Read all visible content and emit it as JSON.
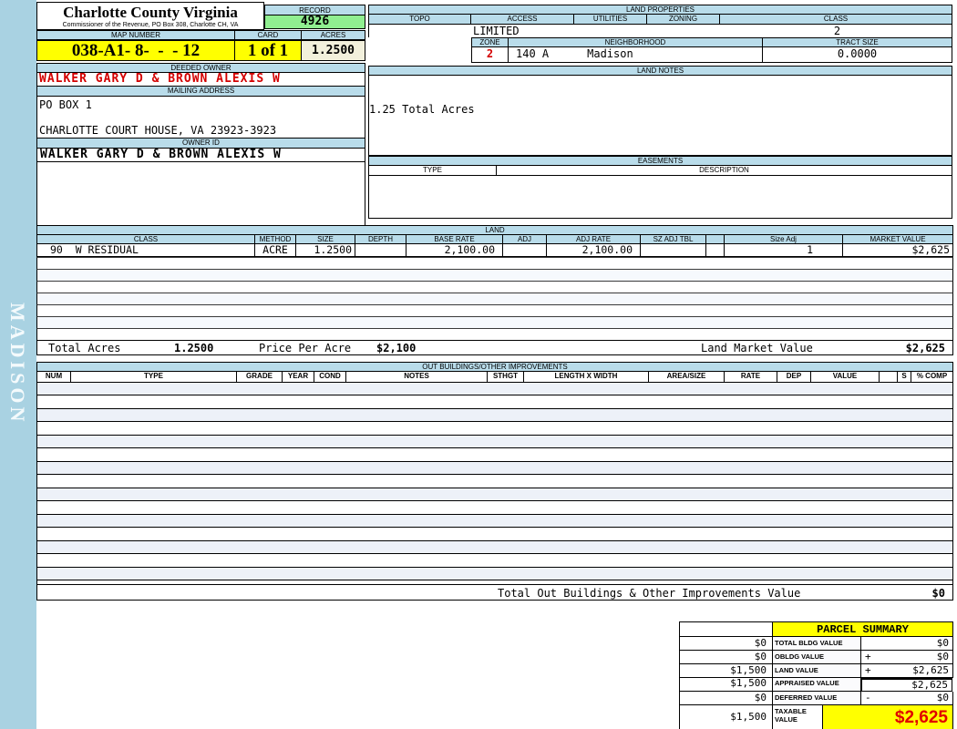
{
  "sidebar": {
    "district_label": "MADISON"
  },
  "header": {
    "county_title": "Charlotte County Virginia",
    "commissioner_line": "Commissioner of the Revenue, PO Box 308, Charlotte CH, VA",
    "record_label": "RECORD",
    "record_value": "4926",
    "map_number_label": "MAP NUMBER",
    "map_number_value": "038-A1- 8-  -  - 12",
    "card_label": "CARD",
    "card_value": "1 of 1",
    "acres_label": "ACRES",
    "acres_value": "1.2500"
  },
  "owner": {
    "deeded_owner_label": "DEEDED OWNER",
    "deeded_owner_value": "WALKER GARY D & BROWN ALEXIS W",
    "mailing_address_label": "MAILING ADDRESS",
    "mailing_address_line1": "PO BOX 1",
    "mailing_address_line2": "CHARLOTTE COURT HOUSE, VA 23923-3923",
    "owner_id_label": "OWNER ID",
    "owner_id_value": "WALKER GARY D & BROWN ALEXIS W"
  },
  "land_properties": {
    "title": "LAND PROPERTIES",
    "topo_label": "TOPO",
    "access_label": "ACCESS",
    "utilities_label": "UTILITIES",
    "zoning_label": "ZONING",
    "class_label": "CLASS",
    "topo_value": "",
    "access_value": "LIMITED",
    "utilities_value": "",
    "zoning_value": "",
    "class_value": "2",
    "zone_label": "ZONE",
    "neighborhood_label": "NEIGHBORHOOD",
    "tract_size_label": "TRACT SIZE",
    "zone_value": "2",
    "neighborhood_code": "140 A",
    "neighborhood_name": "Madison",
    "tract_size_value": "0.0000"
  },
  "land_notes": {
    "title": "LAND NOTES",
    "note": "1.25 Total Acres"
  },
  "easements": {
    "title": "EASEMENTS",
    "type_label": "TYPE",
    "description_label": "DESCRIPTION"
  },
  "land_table": {
    "title": "LAND",
    "headers": [
      "CLASS",
      "METHOD",
      "SIZE",
      "DEPTH",
      "BASE RATE",
      "ADJ",
      "ADJ RATE",
      "SZ ADJ TBL",
      "",
      "Size Adj",
      "MARKET VALUE"
    ],
    "rows": [
      {
        "class": "90  W RESIDUAL",
        "method": "ACRE",
        "size": "1.2500",
        "depth": "",
        "base_rate": "2,100.00",
        "adj": "",
        "adj_rate": "2,100.00",
        "sz_adj_tbl": "",
        "size_adj": "1",
        "market_value": "$2,625"
      }
    ],
    "empty_row_count": 7,
    "totals": {
      "total_acres_label": "Total Acres",
      "total_acres_value": "1.2500",
      "price_per_acre_label": "Price Per Acre",
      "price_per_acre_value": "$2,100",
      "land_market_value_label": "Land Market Value",
      "land_market_value": "$2,625"
    }
  },
  "out_buildings": {
    "title": "OUT BUILDINGS/OTHER IMPROVEMENTS",
    "headers": [
      "NUM",
      "TYPE",
      "GRADE",
      "YEAR",
      "COND",
      "NOTES",
      "STHGT",
      "LENGTH X WIDTH",
      "AREA/SIZE",
      "RATE",
      "DEP",
      "VALUE",
      "",
      "S",
      "% COMP"
    ],
    "total_label": "Total Out Buildings & Other Improvements Value",
    "total_value": "$0"
  },
  "parcel_summary": {
    "title": "PARCEL SUMMARY",
    "rows": [
      {
        "prior": "$0",
        "label": "TOTAL BLDG VALUE",
        "sign": "",
        "value": "$0"
      },
      {
        "prior": "$0",
        "label": "OBLDG VALUE",
        "sign": "+",
        "value": "$0"
      },
      {
        "prior": "$1,500",
        "label": "LAND VALUE",
        "sign": "+",
        "value": "$2,625"
      },
      {
        "prior": "$1,500",
        "label": "APPRAISED VALUE",
        "sign": "",
        "value": "$2,625"
      },
      {
        "prior": "$0",
        "label": "DEFERRED VALUE",
        "sign": "-",
        "value": "$0"
      },
      {
        "prior": "$1,500",
        "label_line1": "TAXABLE",
        "label_line2": "VALUE",
        "sign": "",
        "value": "$2,625"
      }
    ]
  },
  "colors": {
    "accent_yellow": "#ffff00",
    "record_green": "#90ee90",
    "header_blue": "#b9dcea",
    "strip_blue": "#a9d2e2",
    "acres_cream": "#f2f0dc",
    "alert_red": "#d40000"
  }
}
